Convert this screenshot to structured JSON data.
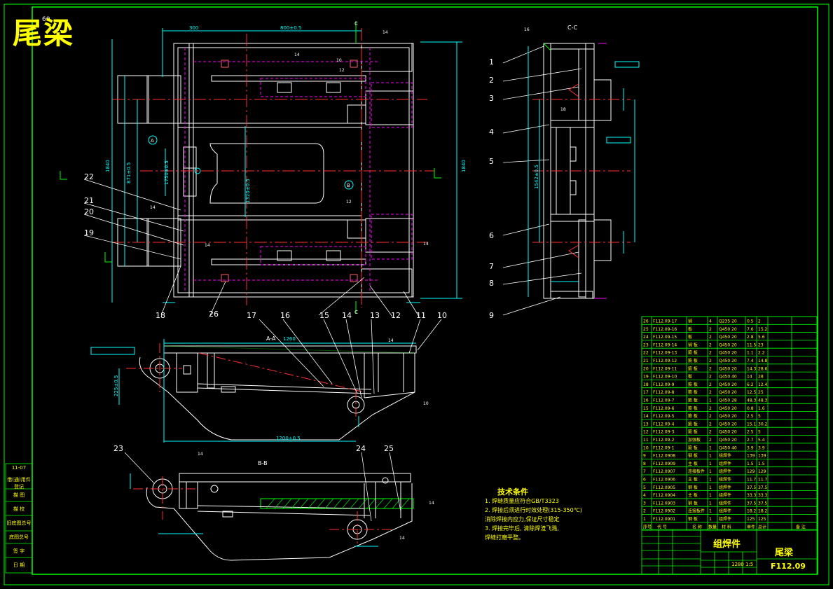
{
  "title": "尾梁",
  "view_labels": {
    "section_cc": "C-C",
    "section_aa": "A-A",
    "section_bb": "B-B",
    "ref_a": "A",
    "ref_b": "B",
    "ref_c": "C"
  },
  "dims": {
    "top_width": "800±0.5",
    "top_left": "300",
    "side_1": "871±0.5",
    "side_2": "1320±0.5",
    "side_3": "1750±0.5",
    "bottom_len": "1200±0.5",
    "aa_len": "1260",
    "aa_height": "225±0.5",
    "height_right": "1840",
    "height_left": "1840",
    "small_1": "60",
    "sec_height": "1542±0.5"
  },
  "weld_marks": [
    "14",
    "12",
    "10",
    "16",
    "18"
  ],
  "part_numbers": [
    "1",
    "2",
    "3",
    "4",
    "5",
    "6",
    "7",
    "8",
    "9",
    "10",
    "11",
    "12",
    "13",
    "14",
    "15",
    "16",
    "17",
    "18",
    "19",
    "20",
    "21",
    "22",
    "23",
    "24",
    "25",
    "26"
  ],
  "tech": {
    "heading": "技术条件",
    "lines": [
      "1. 焊缝质量应符合GB/T3323",
      "2. 焊接后须进行时效处理(315-350℃)",
      "   消除焊接内应力,保证尺寸稳定",
      "3. 焊接完毕后, 清除焊渣飞溅,",
      "   焊缝打磨平整。"
    ]
  },
  "bom": {
    "rows": [
      [
        "26",
        "F112.09-17",
        "销",
        "4",
        "Q235 20",
        "0.5",
        "2"
      ],
      [
        "25",
        "F112.09-16",
        "板",
        "2",
        "Q450 20",
        "7.6",
        "15.2"
      ],
      [
        "24",
        "F112.09-15",
        "板",
        "2",
        "Q450 20",
        "2.8",
        "5.6"
      ],
      [
        "23",
        "F112.09-14",
        "销 板",
        "2",
        "Q450 20",
        "11.5",
        "23"
      ],
      [
        "22",
        "F112.09-13",
        "筋 板",
        "2",
        "Q450 20",
        "1.1",
        "2.2"
      ],
      [
        "21",
        "F112.09-12",
        "筋 板",
        "2",
        "Q450 20",
        "7.4",
        "14.8"
      ],
      [
        "20",
        "F112.09-11",
        "筋 板",
        "2",
        "Q450 20",
        "14.3",
        "28.6"
      ],
      [
        "19",
        "F112.09-10",
        "板",
        "2",
        "Q450 40",
        "14",
        "28"
      ],
      [
        "18",
        "F112.09-9",
        "筋 板",
        "2",
        "Q450 20",
        "6.2",
        "12.4"
      ],
      [
        "17",
        "F112.09-8",
        "筋 板",
        "2",
        "Q450 20",
        "12.5",
        "25"
      ],
      [
        "16",
        "F112.09-7",
        "筋 板",
        "1",
        "Q450 28",
        "48.3",
        "48.3"
      ],
      [
        "15",
        "F112.09-6",
        "筋 板",
        "2",
        "Q450 20",
        "0.8",
        "1.6"
      ],
      [
        "14",
        "F112.09-5",
        "筋 板",
        "2",
        "Q450 20",
        "2.5",
        "5"
      ],
      [
        "13",
        "F112.09-4",
        "筋 板",
        "2",
        "Q450 20",
        "15.1",
        "30.2"
      ],
      [
        "12",
        "F112.09-3",
        "筋 板",
        "2",
        "Q450 20",
        "2.5",
        "5"
      ],
      [
        "11",
        "F112.09-2",
        "加强板",
        "2",
        "Q450 20",
        "2.7",
        "5.4"
      ],
      [
        "10",
        "F112.09-1",
        "筋 板",
        "1",
        "Q450 40",
        "3.9",
        "3.9"
      ],
      [
        "9",
        "F112.0908",
        "钢 板",
        "1",
        "组焊件",
        "139",
        "139"
      ],
      [
        "8",
        "F112.0909",
        "主 板",
        "1",
        "组焊件",
        "1.5",
        "1.5"
      ],
      [
        "7",
        "F112.0907",
        "连接板件",
        "1",
        "组焊件",
        "129",
        "129"
      ],
      [
        "6",
        "F112.0906",
        "主 板",
        "1",
        "组焊件",
        "11.7",
        "11.7"
      ],
      [
        "5",
        "F112.0905",
        "钢 板",
        "1",
        "组焊件",
        "37.5",
        "37.5"
      ],
      [
        "4",
        "F112.0904",
        "主 板",
        "1",
        "组焊件",
        "33.3",
        "33.3"
      ],
      [
        "3",
        "F112.0903",
        "钢 板",
        "1",
        "组焊件",
        "37.5",
        "37.5"
      ],
      [
        "2",
        "F112.0902",
        "连接板件",
        "1",
        "组焊件",
        "18.2",
        "18.2"
      ],
      [
        "1",
        "F112.0901",
        "钢 板",
        "1",
        "组焊件",
        "125",
        "125"
      ]
    ],
    "header": [
      "序号",
      "代 号",
      "名 称",
      "数量",
      "材 料",
      "单件",
      "总计",
      "备 注"
    ]
  },
  "title_block": {
    "type": "组焊件",
    "name": "尾梁",
    "code": "F112.09",
    "scale": "1:5",
    "weight": "1280"
  },
  "side_table": [
    "11-07",
    "借(通)用件登记",
    "描 图",
    "描 校",
    "旧底图总号",
    "底图总号",
    "签 字",
    "日 期"
  ],
  "colors": {
    "frame": "#00ff00",
    "line": "#ffffff",
    "center": "#ff0000",
    "hidden": "#ff00ff",
    "dim": "#00ffff",
    "text": "#ffff00",
    "hatch": "#00ff00"
  }
}
